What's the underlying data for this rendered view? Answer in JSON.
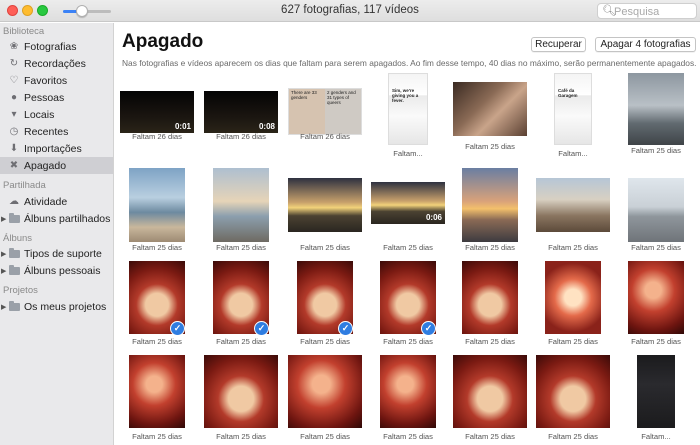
{
  "window": {
    "title": "627 fotografias, 117 vídeos",
    "search_placeholder": "Pesquisa",
    "zoom_level": 0.4
  },
  "sidebar": {
    "sections": [
      {
        "header": "Biblioteca",
        "items": [
          {
            "label": "Fotografias",
            "icon": "photos-icon"
          },
          {
            "label": "Recordações",
            "icon": "memories-icon"
          },
          {
            "label": "Favoritos",
            "icon": "heart-icon"
          },
          {
            "label": "Pessoas",
            "icon": "person-icon"
          },
          {
            "label": "Locais",
            "icon": "pin-icon"
          },
          {
            "label": "Recentes",
            "icon": "clock-icon"
          },
          {
            "label": "Importações",
            "icon": "import-icon"
          },
          {
            "label": "Apagado",
            "icon": "trash-icon",
            "selected": true
          }
        ]
      },
      {
        "header": "Partilhada",
        "items": [
          {
            "label": "Atividade",
            "icon": "cloud-icon"
          },
          {
            "label": "Álbuns partilhados",
            "icon": "folder-icon",
            "disclosure": true
          }
        ]
      },
      {
        "header": "Álbuns",
        "items": [
          {
            "label": "Tipos de suporte",
            "icon": "folder-icon",
            "disclosure": true
          },
          {
            "label": "Álbuns pessoais",
            "icon": "folder-icon",
            "disclosure": true
          }
        ]
      },
      {
        "header": "Projetos",
        "items": [
          {
            "label": "Os meus projetos",
            "icon": "folder-icon",
            "disclosure": true
          }
        ]
      }
    ]
  },
  "main": {
    "title": "Apagado",
    "recover_label": "Recuperar",
    "delete_label": "Apagar 4 fotografias",
    "description": "Nas fotografias e vídeos aparecem os dias que faltam para serem apagados. Ao fim desse tempo, 40 dias no máximo, serão permanentemente apagados.",
    "rows": [
      [
        {
          "caption": "Faltam 26 dias",
          "duration": "0:01",
          "kind": "night-video"
        },
        {
          "caption": "Faltam 26 dias",
          "duration": "0:08",
          "kind": "night-video"
        },
        {
          "caption": "Faltam 26 dias",
          "kind": "meme",
          "meme_text_left": "There are 33 genders",
          "meme_text_right": "2 genders and 31 types of queers"
        },
        {
          "caption": "Faltam...",
          "kind": "screenshot",
          "screen_text": "Sim, we're giving you a fever."
        },
        {
          "caption": "Faltam 25 dias",
          "kind": "store"
        },
        {
          "caption": "Faltam...",
          "kind": "screenshot",
          "screen_text": "Café da Garagem"
        },
        {
          "caption": "Faltam 25 dias",
          "kind": "car-road"
        }
      ],
      [
        {
          "caption": "Faltam 25 dias",
          "kind": "beach-portrait"
        },
        {
          "caption": "Faltam 25 dias",
          "kind": "beach-sunset-portrait"
        },
        {
          "caption": "Faltam 25 dias",
          "kind": "sunset-wide"
        },
        {
          "caption": "Faltam 25 dias",
          "duration": "0:06",
          "kind": "sunset-wide"
        },
        {
          "caption": "Faltam 25 dias",
          "kind": "sunset-portrait"
        },
        {
          "caption": "Faltam 25 dias",
          "kind": "sand-feet"
        },
        {
          "caption": "Faltam 25 dias",
          "kind": "road"
        }
      ],
      [
        {
          "caption": "Faltam 25 dias",
          "kind": "red-food",
          "selected": true
        },
        {
          "caption": "Faltam 25 dias",
          "kind": "red-food",
          "selected": true
        },
        {
          "caption": "Faltam 25 dias",
          "kind": "red-food",
          "selected": true
        },
        {
          "caption": "Faltam 25 dias",
          "kind": "red-food",
          "selected": true
        },
        {
          "caption": "Faltam 25 dias",
          "kind": "red-food"
        },
        {
          "caption": "Faltam 25 dias",
          "kind": "red-drink"
        },
        {
          "caption": "Faltam 25 dias",
          "kind": "red-person"
        }
      ],
      [
        {
          "caption": "Faltam 25 dias",
          "kind": "red-person"
        },
        {
          "caption": "Faltam 25 dias",
          "kind": "red-food"
        },
        {
          "caption": "Faltam 25 dias",
          "kind": "red-person"
        },
        {
          "caption": "Faltam 25 dias",
          "kind": "red-person"
        },
        {
          "caption": "Faltam 25 dias",
          "kind": "red-food"
        },
        {
          "caption": "Faltam 25 dias",
          "kind": "red-food"
        },
        {
          "caption": "Faltam...",
          "kind": "dark-screenshot"
        }
      ]
    ]
  },
  "colors": {
    "accent": "#2f7de1",
    "sidebar_bg": "#e9e9eb",
    "sidebar_selected": "#cfcfd3"
  }
}
